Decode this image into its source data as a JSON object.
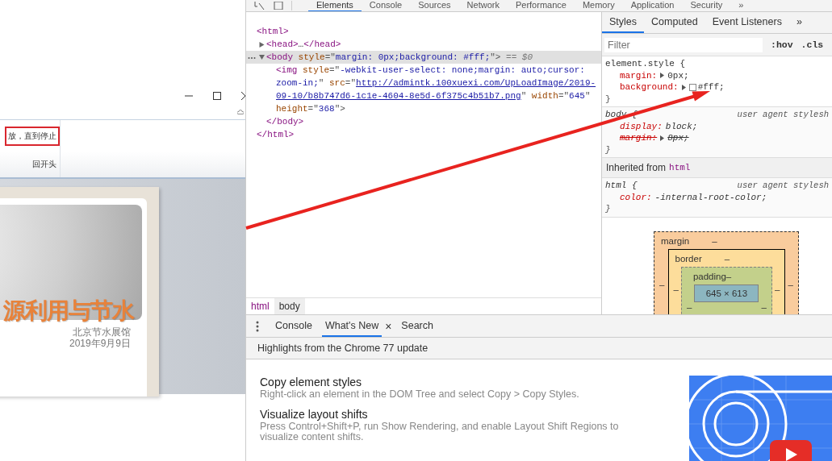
{
  "slide_window": {
    "ribbon_options": [
      {
        "label": "放，直到停止",
        "highlighted": true
      },
      {
        "label": "回开头",
        "highlighted": false
      }
    ],
    "slide": {
      "title": "源利用与节水",
      "subtitle": "北京节水展馆",
      "date": "2019年9月9日"
    }
  },
  "devtools": {
    "tabs": [
      {
        "label": "Elements",
        "selected": true
      },
      {
        "label": "Console",
        "selected": false
      },
      {
        "label": "Sources",
        "selected": false
      },
      {
        "label": "Network",
        "selected": false
      },
      {
        "label": "Performance",
        "selected": false
      },
      {
        "label": "Memory",
        "selected": false
      },
      {
        "label": "Application",
        "selected": false
      },
      {
        "label": "Security",
        "selected": false
      }
    ],
    "more_tabs": "»",
    "dom": {
      "selected": false,
      "lines": [
        [
          {
            "kind": "tag",
            "text": "<html>"
          }
        ]
      ],
      "children": [
        {
          "selected": false,
          "expanded": false,
          "lines": [
            [
              {
                "kind": "tag",
                "text": "<head>"
              },
              {
                "kind": "plain",
                "text": "…"
              },
              {
                "kind": "tag",
                "text": "</head>"
              }
            ]
          ]
        },
        {
          "selected": true,
          "expanded": true,
          "lines": [
            [
              {
                "kind": "tag",
                "text": "<body"
              },
              {
                "kind": "attr",
                "text": " style"
              },
              {
                "kind": "punct",
                "text": "=\""
              },
              {
                "kind": "value",
                "text": "margin: 0px;background: #fff;"
              },
              {
                "kind": "punct",
                "text": "\">"
              },
              {
                "kind": "ref",
                "text": " == $0"
              }
            ]
          ],
          "children": [
            {
              "selected": false,
              "lines": [
                [
                  {
                    "kind": "tag",
                    "text": "<img"
                  },
                  {
                    "kind": "attr",
                    "text": " style"
                  },
                  {
                    "kind": "punct",
                    "text": "=\""
                  },
                  {
                    "kind": "value",
                    "text": "-webkit-user-select: none;margin: auto;cursor:"
                  }
                ],
                [
                  {
                    "kind": "value",
                    "text": "zoom-in;"
                  },
                  {
                    "kind": "punct",
                    "text": "\""
                  },
                  {
                    "kind": "attr",
                    "text": " src"
                  },
                  {
                    "kind": "punct",
                    "text": "=\""
                  },
                  {
                    "kind": "link",
                    "text": "http://admintk.100xuexi.com/UpLoadImage/2019-"
                  }
                ],
                [
                  {
                    "kind": "link",
                    "text": "09-10/b8b747d6-1c1e-4604-8e5d-6f375c4b51b7.png"
                  },
                  {
                    "kind": "punct",
                    "text": "\""
                  },
                  {
                    "kind": "attr",
                    "text": " width"
                  },
                  {
                    "kind": "punct",
                    "text": "=\""
                  },
                  {
                    "kind": "value",
                    "text": "645"
                  },
                  {
                    "kind": "punct",
                    "text": "\""
                  }
                ],
                [
                  {
                    "kind": "attr",
                    "text": "height"
                  },
                  {
                    "kind": "punct",
                    "text": "=\""
                  },
                  {
                    "kind": "value",
                    "text": "368"
                  },
                  {
                    "kind": "punct",
                    "text": "\">"
                  }
                ]
              ]
            }
          ],
          "closing": [
            {
              "kind": "tag",
              "text": "</body>"
            }
          ]
        }
      ],
      "closing": [
        {
          "kind": "tag",
          "text": "</html>"
        }
      ]
    },
    "breadcrumbs": [
      {
        "label": "html",
        "selected": false
      },
      {
        "label": "body",
        "selected": true
      }
    ],
    "sidebar_tabs": [
      {
        "label": "Styles",
        "selected": true
      },
      {
        "label": "Computed",
        "selected": false
      },
      {
        "label": "Event Listeners",
        "selected": false
      }
    ],
    "sidebar_more": "»",
    "filter": {
      "placeholder": "Filter"
    },
    "filter_buttons": [
      ":hov",
      ".cls"
    ],
    "rules": [
      {
        "selector": "element.style {",
        "user_agent": false,
        "properties": [
          {
            "name": "margin:",
            "value": "0px;",
            "expandable": true,
            "swatch": false,
            "struck": false
          },
          {
            "name": "background:",
            "value": "#fff;",
            "expandable": true,
            "swatch": true,
            "struck": false
          }
        ],
        "close": "}"
      },
      {
        "selector": "body {",
        "source": "user agent stylesh",
        "user_agent": true,
        "properties": [
          {
            "name": "display:",
            "value": "block;",
            "expandable": false,
            "swatch": false,
            "struck": false
          },
          {
            "name": "margin:",
            "value": "8px;",
            "expandable": true,
            "swatch": false,
            "struck": true
          }
        ],
        "close": "}"
      },
      {
        "selector": "html {",
        "source": "user agent stylesh",
        "user_agent": true,
        "inherited_from": "html",
        "properties": [
          {
            "name": "color:",
            "value": "-internal-root-color;",
            "expandable": false,
            "swatch": false,
            "struck": false
          }
        ],
        "close": "}"
      }
    ],
    "inherited_label": "Inherited from",
    "box_model": {
      "margin_label": "margin",
      "margin_value": "–",
      "border_label": "border",
      "border_value": "–",
      "padding_label": "padding",
      "padding_value": "–",
      "content": "645 × 613",
      "left": [
        "–",
        "–",
        "–"
      ],
      "right": [
        "–",
        "–",
        "–"
      ]
    },
    "drawer": {
      "tabs": [
        {
          "label": "Console",
          "selected": false,
          "closable": false
        },
        {
          "label": "What's New",
          "selected": true,
          "closable": true
        },
        {
          "label": "Search",
          "selected": false,
          "closable": false
        }
      ],
      "close_glyph": "×",
      "banner": "Highlights from the Chrome 77 update",
      "items": [
        {
          "title": "Copy element styles",
          "description": "Right-click an element in the DOM Tree and select Copy > Copy Styles."
        },
        {
          "title": "Visualize layout shifts",
          "description": "Press Control+Shift+P, run Show Rendering, and enable Layout Shift Regions to visualize content shifts."
        }
      ]
    }
  }
}
